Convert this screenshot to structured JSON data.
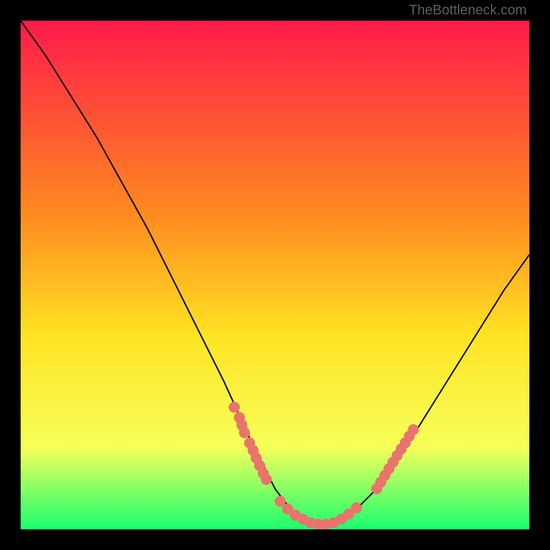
{
  "watermark": "TheBottleneck.com",
  "colors": {
    "frame": "#000000",
    "gradient_top": "#ff1a4b",
    "gradient_mid1": "#ff8a1f",
    "gradient_mid2": "#ffe423",
    "gradient_mid3": "#f6ff5a",
    "gradient_bottom": "#19ff6e",
    "curve": "#000000",
    "dots": "#e8746d"
  },
  "chart_data": {
    "type": "line",
    "title": "",
    "xlabel": "",
    "ylabel": "",
    "xlim": [
      0,
      100
    ],
    "ylim": [
      0,
      100
    ],
    "series": [
      {
        "name": "bottleneck-curve",
        "x": [
          0,
          5,
          10,
          15,
          20,
          25,
          30,
          35,
          40,
          45,
          48,
          50,
          53,
          56,
          58,
          60,
          63,
          66,
          70,
          75,
          80,
          85,
          90,
          95,
          100
        ],
        "y": [
          100,
          93,
          85,
          77,
          68,
          59,
          49,
          39,
          29,
          18,
          12,
          8,
          4,
          2,
          1,
          1,
          2,
          4,
          8,
          15,
          23,
          31,
          39,
          47,
          54
        ]
      }
    ],
    "dot_clusters": [
      {
        "name": "left-cluster",
        "points": [
          [
            42,
            24
          ],
          [
            43,
            22
          ],
          [
            43.5,
            20.5
          ],
          [
            44,
            19
          ],
          [
            45,
            17
          ],
          [
            45.7,
            15.5
          ],
          [
            46.3,
            14
          ],
          [
            47,
            12.5
          ],
          [
            47.7,
            11
          ],
          [
            48.3,
            9.8
          ]
        ]
      },
      {
        "name": "bottom-cluster",
        "points": [
          [
            51,
            5.5
          ],
          [
            52.5,
            4
          ],
          [
            54,
            2.8
          ],
          [
            55.5,
            2
          ],
          [
            57,
            1.3
          ],
          [
            58.5,
            1
          ],
          [
            60,
            1
          ],
          [
            61.5,
            1.3
          ],
          [
            63,
            2
          ],
          [
            64.5,
            3
          ],
          [
            66,
            4.2
          ]
        ]
      },
      {
        "name": "right-cluster",
        "points": [
          [
            70,
            8
          ],
          [
            70.8,
            9.3
          ],
          [
            71.6,
            10.6
          ],
          [
            72.4,
            11.9
          ],
          [
            73.2,
            13.2
          ],
          [
            74,
            14.5
          ],
          [
            74.8,
            15.8
          ],
          [
            75.6,
            17
          ],
          [
            76.4,
            18.3
          ],
          [
            77.2,
            19.6
          ]
        ]
      }
    ]
  }
}
